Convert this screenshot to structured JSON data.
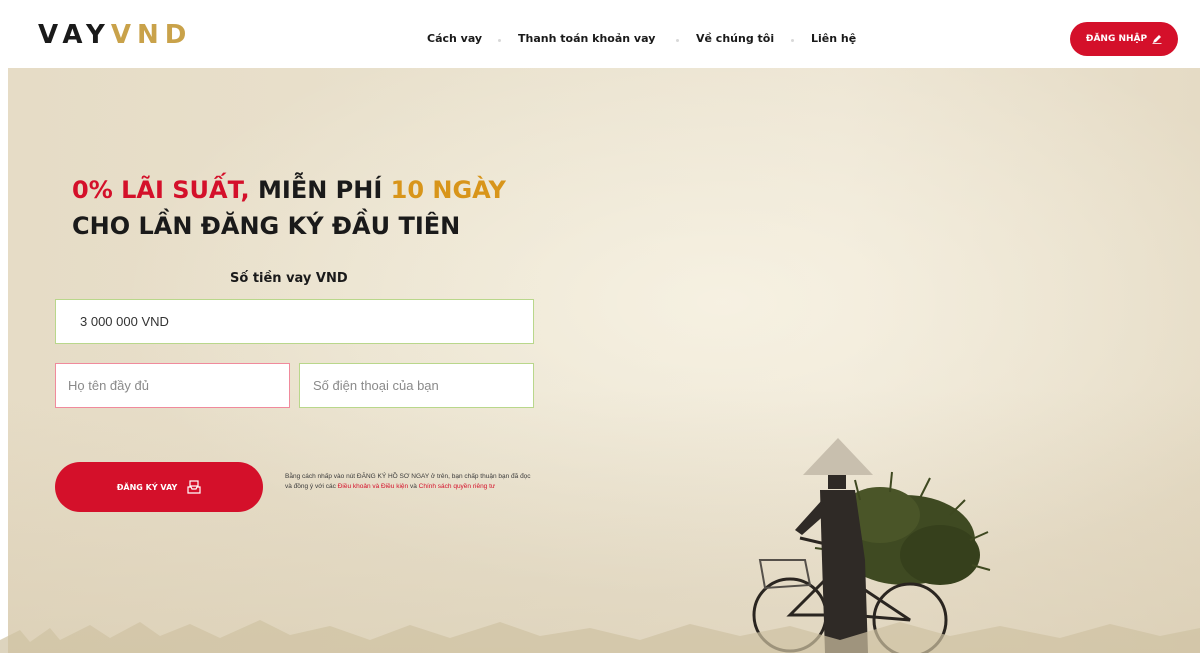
{
  "logo": {
    "part1": "VAY",
    "part2": "VND"
  },
  "nav": {
    "items": [
      {
        "label": "Cách vay"
      },
      {
        "label": "Thanh toán khoản vay"
      },
      {
        "label": "Về chúng tôi"
      },
      {
        "label": "Liên hệ"
      }
    ]
  },
  "header": {
    "login_label": "ĐĂNG NHẬP"
  },
  "hero": {
    "headline_red": "0% LÃI SUẤT,",
    "headline_mid": " MIỄN PHÍ ",
    "headline_gold": "10 NGÀY",
    "headline_line2": "CHO LẦN ĐĂNG KÝ ĐẦU TIÊN",
    "amount_label": "Số tiền vay VND",
    "amount_value": "3 000 000 VND",
    "name_placeholder": "Họ tên đầy đủ",
    "phone_placeholder": "Số điện thoại của bạn",
    "signup_label": "ĐĂNG KÝ VAY",
    "terms_text": "Bằng cách nhấp vào nút ĐĂNG KÝ HỒ SƠ NGAY ở trên, bạn chấp thuận bạn đã đọc và đồng ý với các ",
    "terms_link1": "Điều khoản và Điều kiện",
    "terms_and": " và ",
    "terms_link2": "Chính sách quyền riêng tư"
  },
  "colors": {
    "accent": "#d4102a",
    "gold": "#d8951a",
    "logo_gold": "#c9a24a"
  },
  "icons": {
    "login": "pencil-icon",
    "signup": "inbox-icon"
  }
}
